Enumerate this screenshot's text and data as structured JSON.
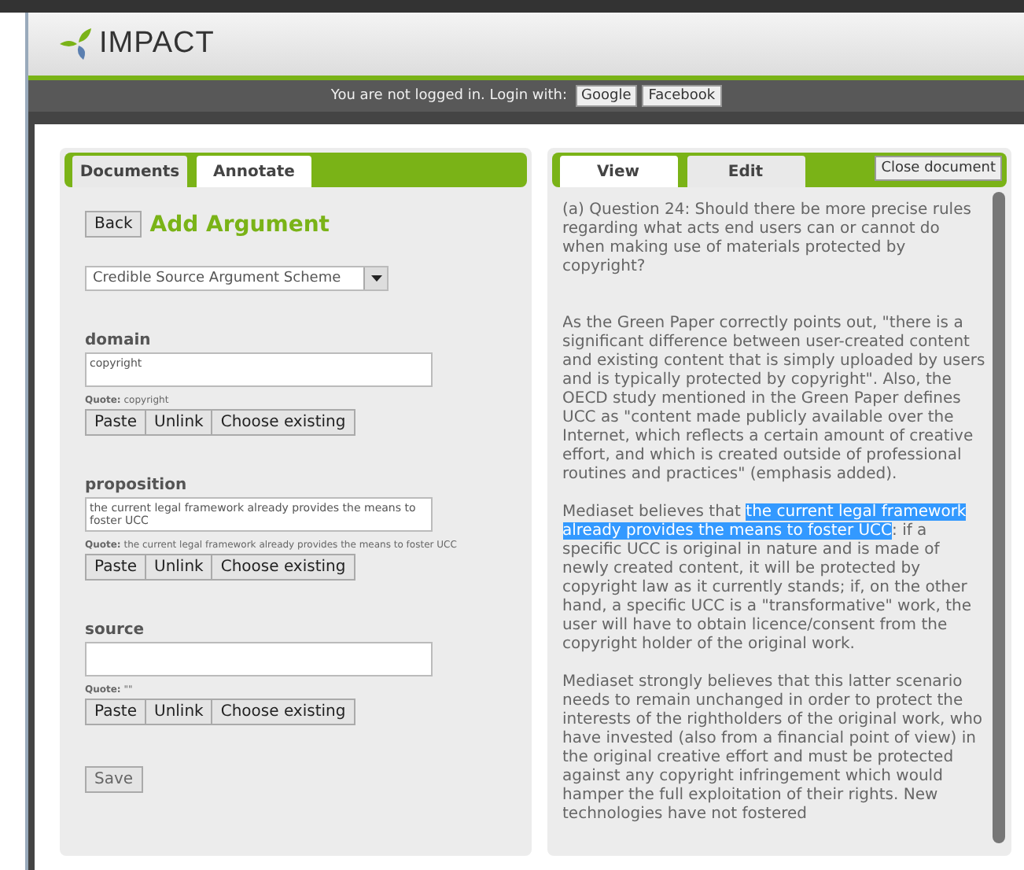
{
  "header": {
    "logo": "IMPACT",
    "login_text": "You are not logged in. Login with:",
    "login_buttons": [
      "Google",
      "Facebook"
    ]
  },
  "left_panel": {
    "tabs": [
      {
        "label": "Documents",
        "selected": false
      },
      {
        "label": "Annotate",
        "selected": true
      }
    ],
    "back_button": "Back",
    "title": "Add Argument",
    "scheme_select": "Credible Source Argument Scheme",
    "fields": [
      {
        "label": "domain",
        "value": "copyright",
        "quote": "**Quote:** copyright",
        "buttons": [
          "Paste",
          "Unlink",
          "Choose existing"
        ]
      },
      {
        "label": "proposition",
        "value": "the current legal framework already provides the means to foster UCC",
        "quote": "**Quote:** the current legal framework already provides the means to foster UCC",
        "buttons": [
          "Paste",
          "Unlink",
          "Choose existing"
        ]
      },
      {
        "label": "source",
        "quote": "**Quote:** \"\"",
        "buttons": [
          "Paste",
          "Unlink",
          "Choose existing"
        ]
      }
    ],
    "save_button": "Save"
  },
  "right_panel": {
    "tabs": [
      {
        "label": "View",
        "selected": true
      },
      {
        "label": "Edit",
        "selected": false
      }
    ],
    "close_button": "Close document",
    "paragraphs": [
      {
        "before": "(a) Question 24: Should there be more precise rules regarding what acts end users can or cannot do when making use of materials protected by copyright?"
      },
      {
        "before": "As the Green Paper correctly points out, \"there is a significant difference between user-created content and existing content that is simply uploaded by users and is typically protected by copyright\". Also, the OECD study mentioned in the Green Paper defines UCC as \"content made publicly available over the Internet, which reflects a certain amount of creative effort, and which is created outside of professional routines and practices\" (emphasis added)."
      },
      {
        "before": "Mediaset believes that ",
        "highlight": "the current legal framework already provides the means to foster UCC",
        "after": ": if a specific UCC is original in nature and is made of newly created content, it will be protected by copyright law as it currently stands; if, on the other hand, a specific UCC is a \"transformative\" work, the user will have to obtain licence/consent from the copyright holder of the original work."
      },
      {
        "before": "Mediaset strongly believes that this latter scenario needs to remain unchanged in order to protect the interests of the rightholders of the original work, who have invested (also from a financial point of view) in the original creative effort and must be protected against any copyright infringement which would hamper the full exploitation of their rights. New technologies have not fostered"
      }
    ]
  }
}
